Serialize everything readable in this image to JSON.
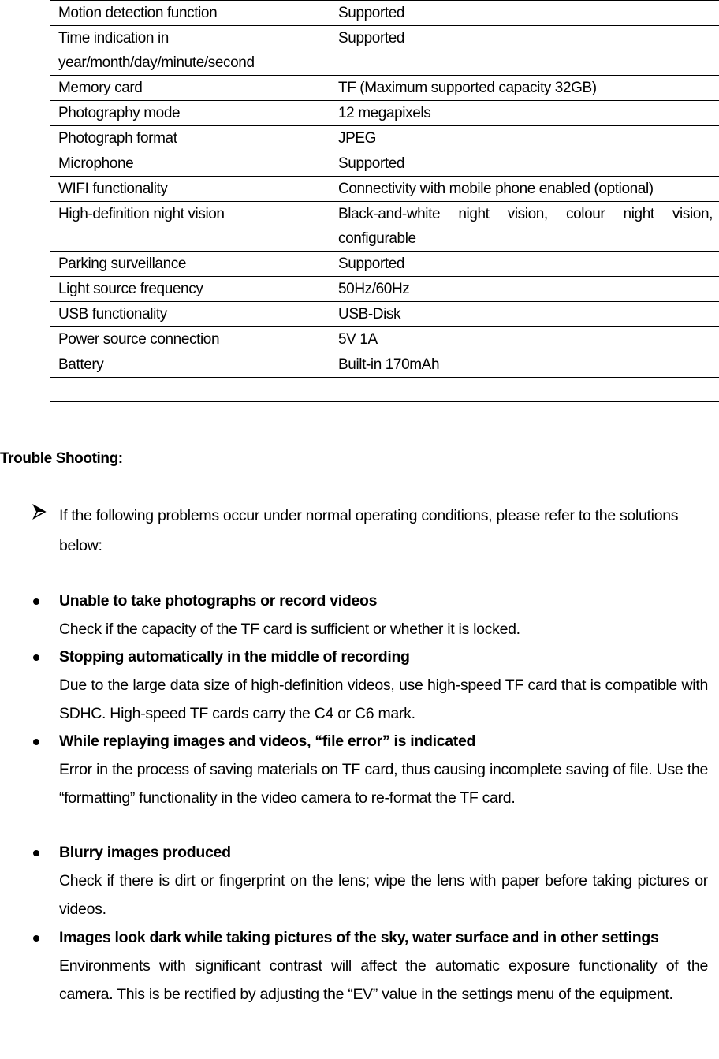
{
  "spec_table": {
    "rows": [
      {
        "feature": "Motion detection function",
        "value": "Supported"
      },
      {
        "feature": "Time indication in year/month/day/minute/second",
        "value": "Supported"
      },
      {
        "feature": "Memory card",
        "value": "TF (Maximum supported capacity 32GB)"
      },
      {
        "feature": "Photography mode",
        "value": "12 megapixels"
      },
      {
        "feature": "Photograph format",
        "value": "JPEG"
      },
      {
        "feature": "Microphone",
        "value": "Supported"
      },
      {
        "feature": "WIFI functionality",
        "value": "Connectivity with mobile phone enabled (optional)"
      },
      {
        "feature": "High-definition night vision",
        "value": "Black-and-white night vision, colour night vision, configurable"
      },
      {
        "feature": "Parking surveillance",
        "value": "Supported"
      },
      {
        "feature": "Light source frequency",
        "value": "50Hz/60Hz"
      },
      {
        "feature": "USB functionality",
        "value": "USB-Disk"
      },
      {
        "feature": "Power source connection",
        "value": "5V 1A"
      },
      {
        "feature": "Battery",
        "value": "Built-in 170mAh"
      },
      {
        "feature": "",
        "value": ""
      }
    ]
  },
  "troubleshooting": {
    "heading": "Trouble Shooting:",
    "intro": "If the following problems occur under normal operating conditions, please refer to the solutions below:",
    "intro_icon": "arrow-bullet-icon",
    "items": [
      {
        "title": "Unable to take photographs or record videos",
        "description": "Check if the capacity of the TF card is sufficient or whether it is locked."
      },
      {
        "title": "Stopping automatically in the middle of recording",
        "description": "Due to the large data size of high-definition videos, use high-speed TF card that is compatible with SDHC. High-speed TF cards carry the C4 or C6 mark."
      },
      {
        "title": "While replaying images and videos, “file error” is indicated",
        "description": "Error in the process of saving materials on TF card, thus causing incomplete saving of file. Use the “formatting” functionality in the video camera to re-format the TF card."
      },
      {
        "title": "Blurry images produced",
        "description": "Check if there is dirt or fingerprint on the lens; wipe the lens with paper before taking pictures or videos."
      },
      {
        "title": "Images look dark while taking pictures of the sky, water surface and in other settings",
        "description": "Environments with significant contrast will affect the automatic exposure functionality of the camera. This is be rectified by adjusting the “EV” value in the settings menu of the equipment."
      }
    ]
  }
}
